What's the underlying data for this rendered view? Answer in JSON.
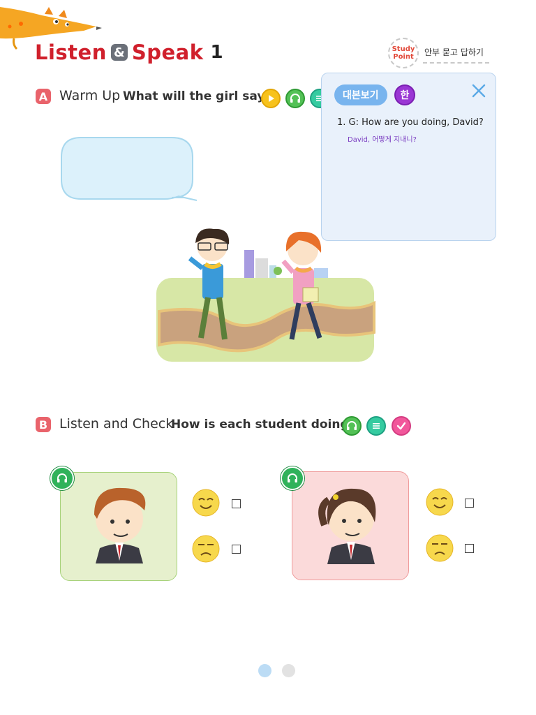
{
  "header": {
    "title_part1": "Listen",
    "title_amp": "&",
    "title_part2": "Speak",
    "title_number": "1",
    "study_point": {
      "badge_line1": "Study",
      "badge_line2": "Point",
      "text": "안부 묻고 답하기"
    }
  },
  "section_a": {
    "badge": "A",
    "label": "Warm Up",
    "question": "What will the girl say?",
    "icons": [
      "play-icon",
      "headphones-icon",
      "script-icon"
    ]
  },
  "script_panel": {
    "button_label": "대본보기",
    "korean_toggle": "한",
    "line": "1. G: How are you doing, David?",
    "translation": "David, 어떻게 지내니?"
  },
  "section_b": {
    "badge": "B",
    "label": "Listen and Check",
    "question": "How is each student doing?",
    "icons": [
      "headphones-icon",
      "script-icon",
      "check-icon"
    ]
  },
  "students": [
    {
      "name": "boy",
      "options": [
        "happy-face-icon",
        "sad-face-icon"
      ]
    },
    {
      "name": "girl",
      "options": [
        "happy-face-icon",
        "sad-face-icon"
      ]
    }
  ],
  "pager": {
    "pages": 2,
    "current": 1
  },
  "colors": {
    "title_red": "#d0202c",
    "section_badge": "#e9636b",
    "script_button": "#78b4ee",
    "korean_toggle": "#9a36d4",
    "card_green": "#e6f0cd",
    "card_pink": "#fbdada"
  }
}
